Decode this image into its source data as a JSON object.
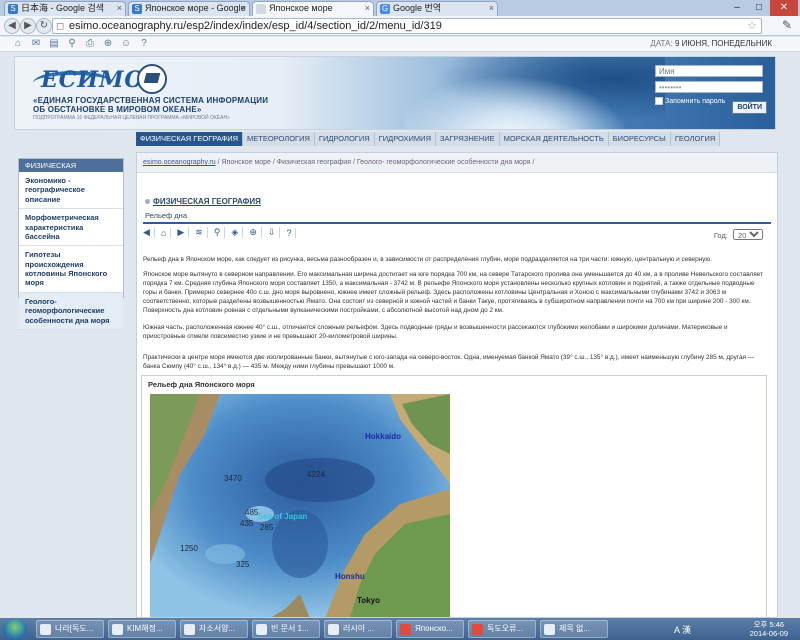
{
  "browser": {
    "tabs": [
      {
        "label": "日本海 - Google 검색",
        "icon": "S"
      },
      {
        "label": "Японское море - Google",
        "icon": "S"
      },
      {
        "label": "Японское море",
        "icon": ""
      },
      {
        "label": "Google 번역",
        "icon": "G"
      }
    ],
    "url": "esimo.oceanography.ru/esp2/index/index/esp_id/4/section_id/2/menu_id/319"
  },
  "site": {
    "date_label": "ДАТА:",
    "date_value": "9 ИЮНЯ, ПОНЕДЕЛЬНИК",
    "logo": "ЕСИМО",
    "org_line1": "«ЕДИНАЯ ГОСУДАРСТВЕННАЯ СИСТЕМА ИНФОРМАЦИИ",
    "org_line2": "ОБ ОБСТАНОВКЕ В МИРОВОМ ОКЕАНЕ»",
    "subprogram": "ПОДПРОГРАММА 16 ФЕДЕРАЛЬНАЯ ЦЕЛЕВАЯ ПРОГРАММА «МИРОВОЙ ОКЕАН»",
    "login": {
      "name_placeholder": "Имя",
      "password_value": "••••••••",
      "remember_label": "Запомнить пароль",
      "enter_label": "ВОЙТИ"
    },
    "menu": [
      "ФИЗИЧЕСКАЯ ГЕОГРАФИЯ",
      "МЕТЕОРОЛОГИЯ",
      "ГИДРОЛОГИЯ",
      "ГИДРОХИМИЯ",
      "ЗАГРЯЗНЕНИЕ",
      "МОРСКАЯ ДЕЯТЕЛЬНОСТЬ",
      "БИОРЕСУРСЫ",
      "ГЕОЛОГИЯ"
    ]
  },
  "sidebar": {
    "heading": "ФИЗИЧЕСКАЯ ГЕОГРАФИЯ",
    "items": [
      "Экономико - географическое описание",
      "Морфометрическая характеристика бассейна",
      "Гипотезы происхождения котловины Японского моря",
      "Геолого-геоморфологические особенности дна моря"
    ]
  },
  "content": {
    "breadcrumb_home": "esimo.oceanography.ru",
    "breadcrumb_rest": " / Японское море / Физическая география / Геолого- геоморфологические особенности дна моря /",
    "section_title": "ФИЗИЧЕСКАЯ ГЕОГРАФИЯ",
    "section_subtitle": "Рельеф дна",
    "toolbar_icons": [
      "◀",
      "⌂",
      "▶",
      "≋",
      "⚲",
      "◈",
      "⊕",
      "⇩",
      "?"
    ],
    "year_label": "Год:",
    "year_value": "2004",
    "paragraphs": [
      "Рельеф дна в Японском море, как следует из рисунка, весьма разнообразен и, в зависимости от распределения глубин, море подразделяется на три части: южную, центральную и северную.",
      "Японское море вытянуто в северном направлении. Его максимальная ширина достигает на юге порядка 700 км, на севере Татарского пролива она уменьшается до 40 км, а в проливе Невельского составляет порядка 7 км. Средняя глубина Японского моря составляет 1350, а максимальная - 3742 м. В рельефе Японского моря установлены несколько крупных котловин и поднятий, а также отдельные подводные горы и банки. Примерно севернее 40о с.ш. дно моря выровнено, южнее имеет сложный рельеф. Здесь расположены котловины Центральная и Хонсю с максимальными глубинами 3742 и 3063 м соответственно, которые разделены возвышенностью Ямато. Она состоит из северной и южной частей и банки Такуе, протягиваясь в субширотном направлении почти на 700 км при ширине 200 - 300 км. Поверхность дна котловин ровная с отдельными вулканическими постройками, с абсолютной высотой над дном до 2 км.",
      "Южная часть, расположенная южнее 40° с.ш., отличается сложным рельефом. Здесь подводные гряды и возвышенности рассекаются глубокими желобами и широкими долинами. Материковые и приостровные отмели повсеместно узкие и не превышают 20-километровой ширины.",
      "Практически в центре моря имеются две изолированные банки, вытянутые с юго-запада на северо-восток. Одна, именуемая банкой Ямато (39° с.ш., 135° в.д.), имеет наименьшую глубину 285 м, другая — банка Сюмпу (40° с.ш., 134° в.д.) — 435 м. Между ними глубины превышают 1000 м."
    ],
    "map_title": "Рельеф дна Японского моря",
    "map_labels": {
      "hokkaido": "Hokkaido",
      "honshu": "Honshu",
      "tokyo": "Tokyo",
      "sea": "Sea of Japan",
      "d3470": "3470",
      "d4224": "4224",
      "d485": "485",
      "d435": "435",
      "d285": "285",
      "d1250": "1250",
      "d325": "325"
    }
  },
  "taskbar": {
    "items": [
      "나라[독도...",
      "KIM해정...",
      "자소서양...",
      "빈 문서 1...",
      "러시아 ...",
      "Японско...",
      "독도오류...",
      "제목 없..."
    ],
    "time_line1": "오후 5:46",
    "time_line2": "2014-06-09",
    "lang": "A 漢"
  },
  "colors": {
    "menu_active": "#27568f",
    "sidebar_head": "#4d6f99",
    "section_rule": "#2a5d97"
  }
}
